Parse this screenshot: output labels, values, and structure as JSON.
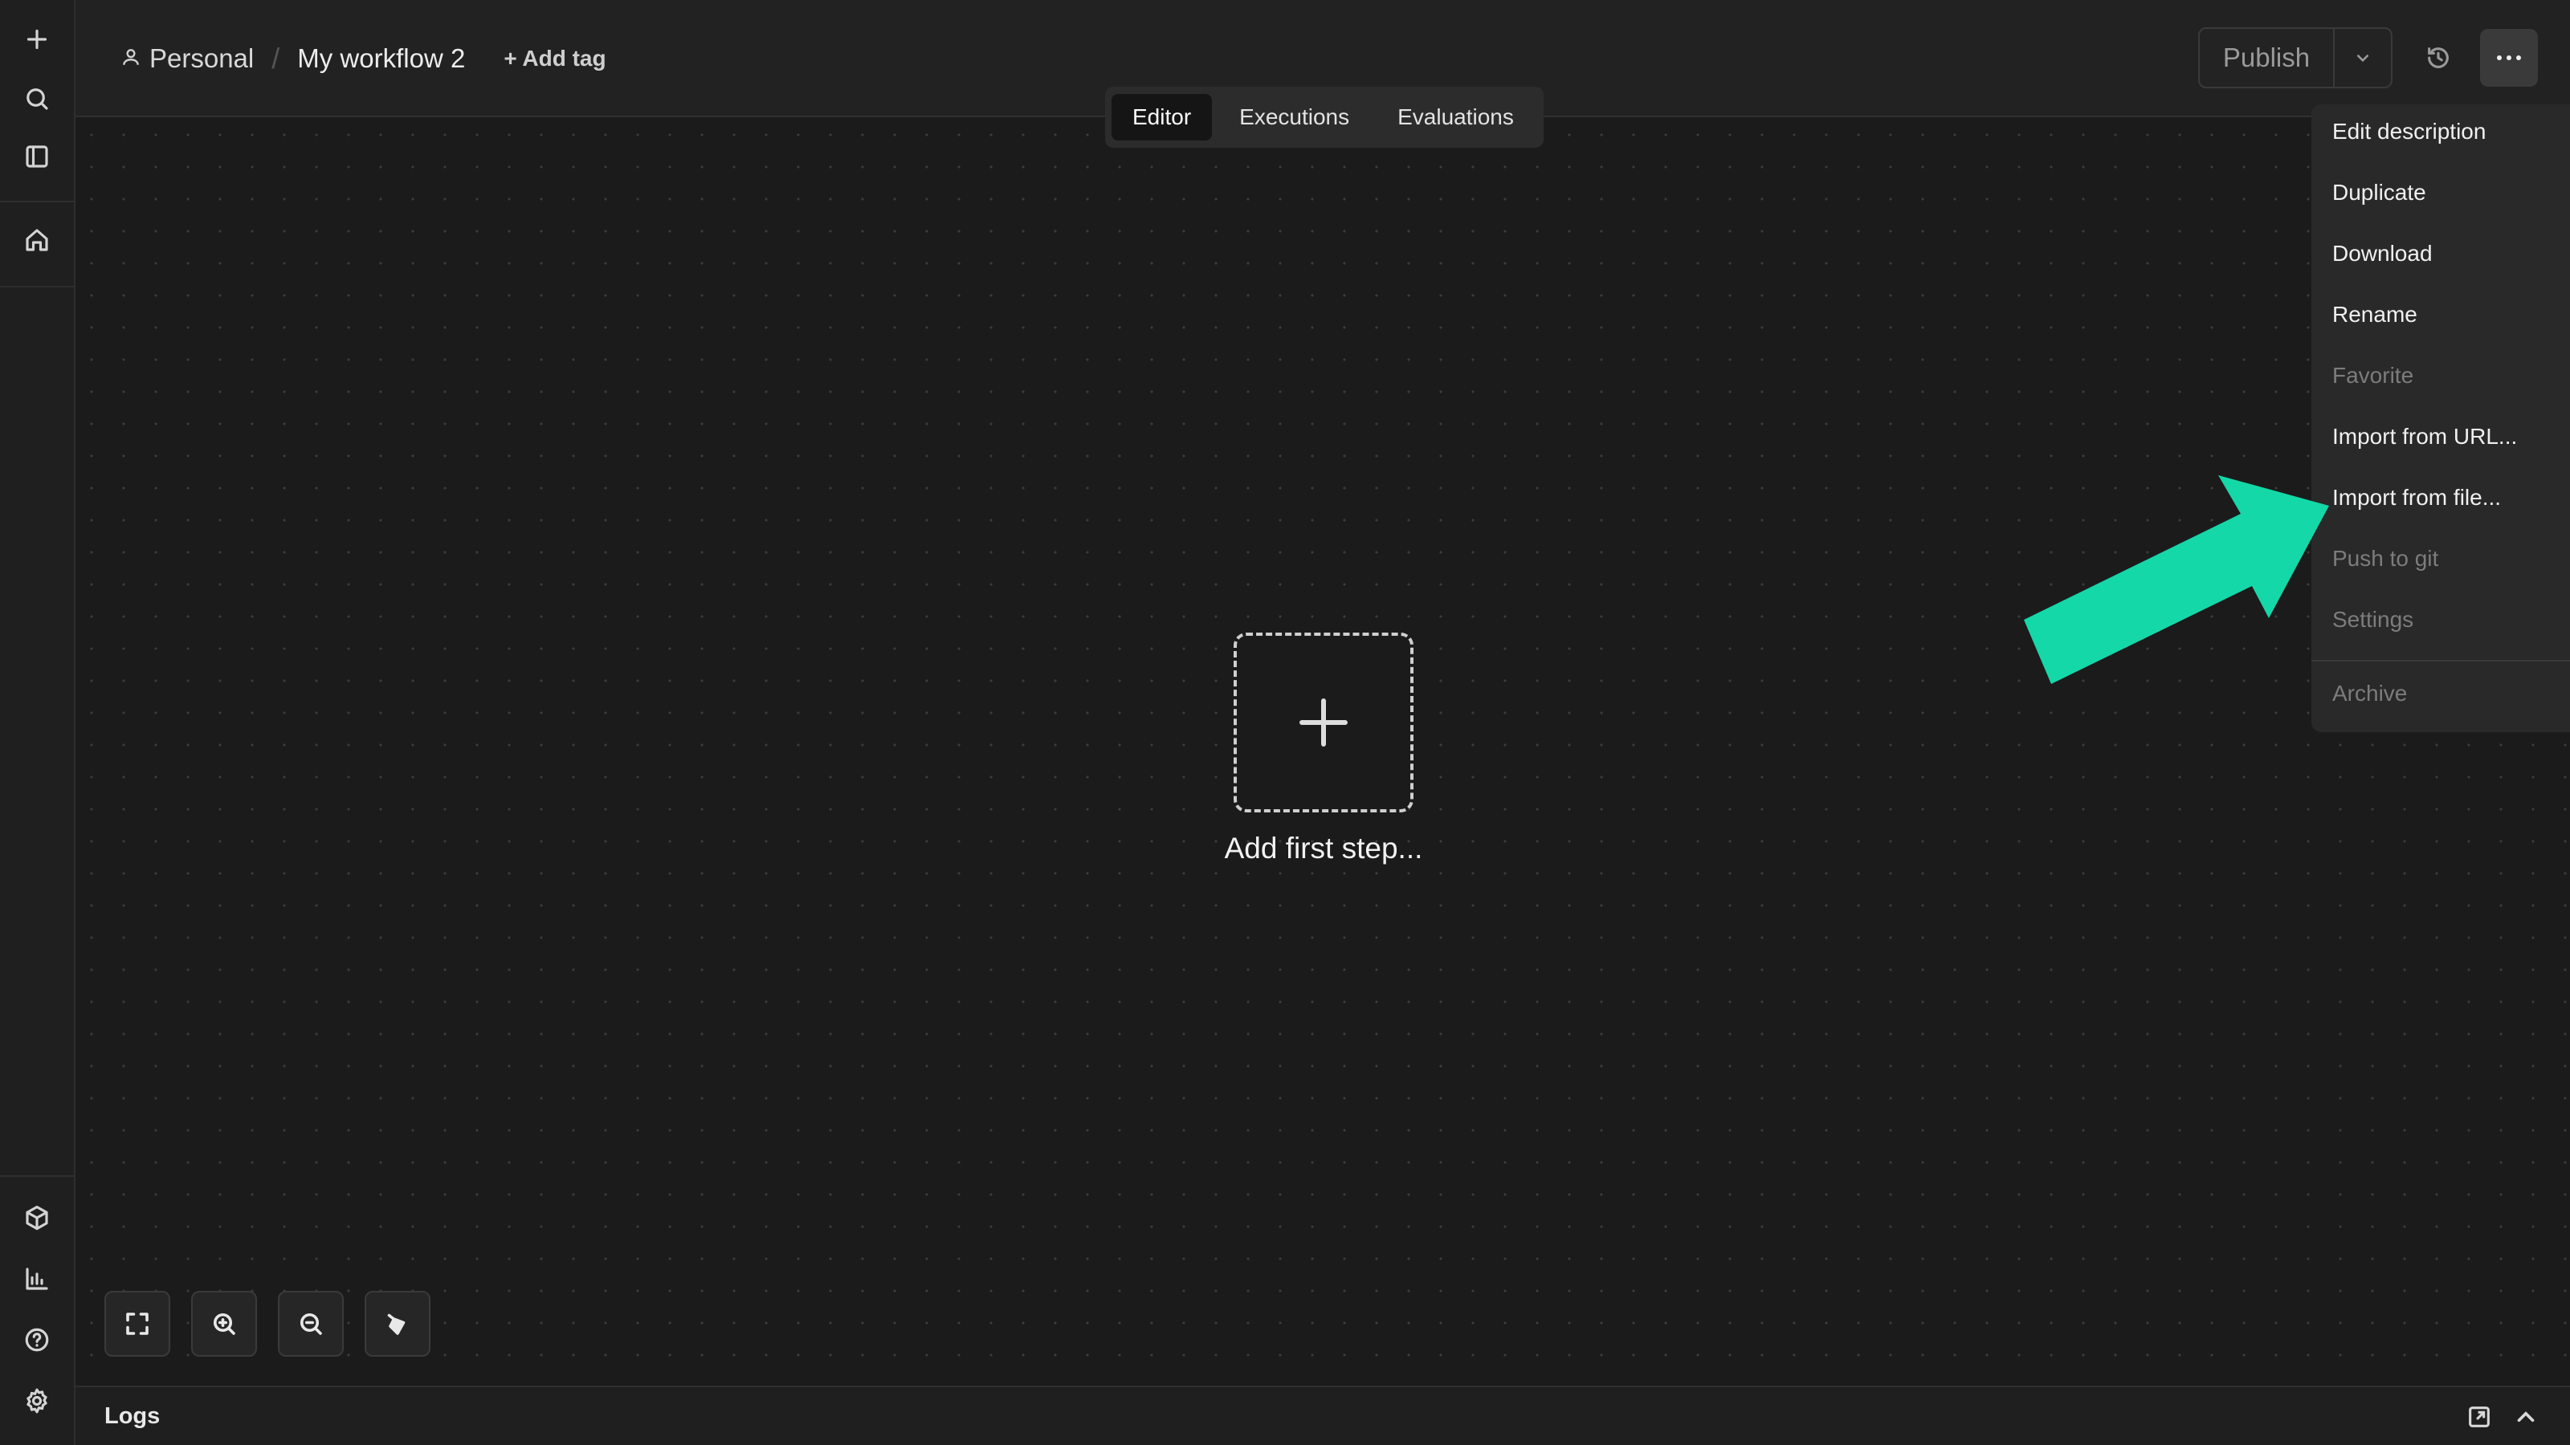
{
  "sidebar": {
    "icons": [
      "plus-icon",
      "search-icon",
      "panel-toggle-icon",
      "home-icon",
      "templates-icon",
      "insights-icon",
      "help-icon",
      "settings-icon"
    ]
  },
  "header": {
    "project": "Personal",
    "separator": "/",
    "workflow_title": "My workflow 2",
    "add_tag": "+ Add tag",
    "publish": "Publish"
  },
  "tabs": [
    {
      "label": "Editor",
      "active": true
    },
    {
      "label": "Executions",
      "active": false
    },
    {
      "label": "Evaluations",
      "active": false
    }
  ],
  "canvas": {
    "add_step_label": "Add first step..."
  },
  "logs": {
    "label": "Logs"
  },
  "menu": {
    "items": [
      {
        "label": "Edit description",
        "enabled": true
      },
      {
        "label": "Duplicate",
        "enabled": true
      },
      {
        "label": "Download",
        "enabled": true
      },
      {
        "label": "Rename",
        "enabled": true
      },
      {
        "label": "Favorite",
        "enabled": false
      },
      {
        "label": "Import from URL...",
        "enabled": true
      },
      {
        "label": "Import from file...",
        "enabled": true
      },
      {
        "label": "Push to git",
        "enabled": false
      },
      {
        "label": "Settings",
        "enabled": false
      },
      {
        "label": "Archive",
        "enabled": false
      }
    ]
  },
  "colors": {
    "accent_arrow": "#14d8a8",
    "background": "#1b1b1b",
    "menu_background": "#292929"
  }
}
